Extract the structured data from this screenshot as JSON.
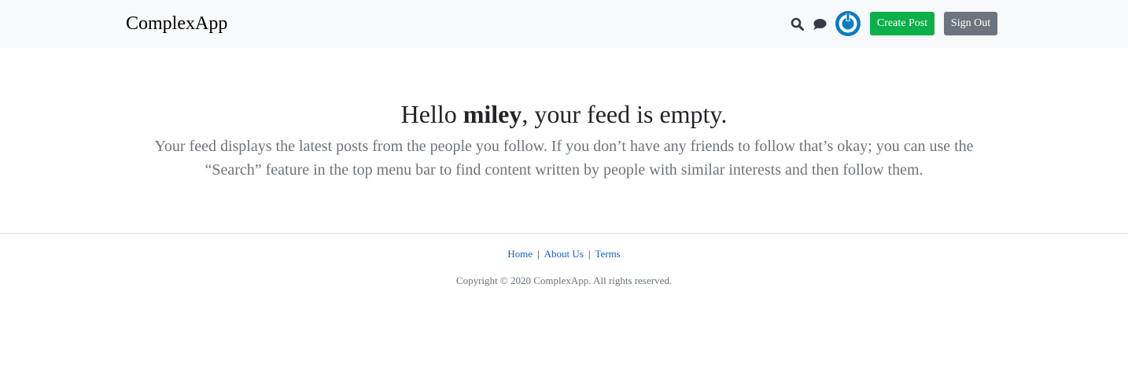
{
  "header": {
    "brand": "ComplexApp",
    "search_icon": "search-icon",
    "chat_icon": "chat-icon",
    "create_post_label": "Create Post",
    "sign_out_label": "Sign Out"
  },
  "colors": {
    "header_bg": "#f8f9fa",
    "create_post": "#0cb04a",
    "sign_out": "#6c757d",
    "link": "#0f5fdc",
    "muted": "#6c757d",
    "avatar": "#0a7bc2"
  },
  "main": {
    "headline_prefix": "Hello ",
    "username": "miley",
    "headline_suffix": ", your feed is empty.",
    "lead": "Your feed displays the latest posts from the people you follow. If you don’t have any friends to follow that’s okay; you can use the “Search” feature in the top menu bar to find content written by people with similar interests and then follow them."
  },
  "footer": {
    "links": [
      "Home",
      "About Us",
      "Terms"
    ],
    "separator": "|",
    "copyright": "Copyright © 2020 ComplexApp. All rights reserved."
  }
}
